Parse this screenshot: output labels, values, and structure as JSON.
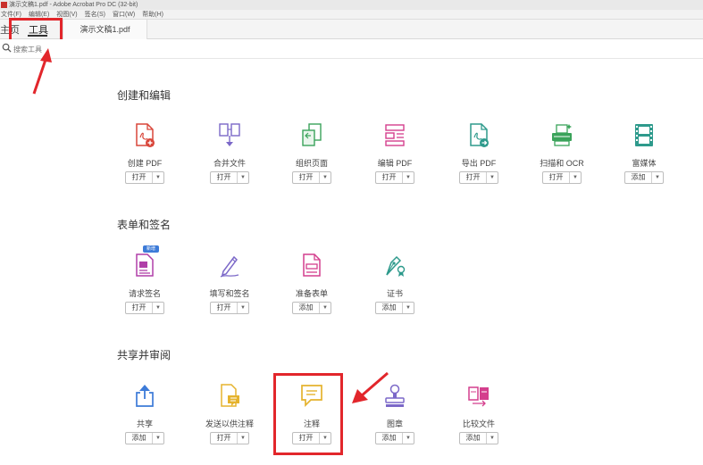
{
  "window": {
    "title": "演示文稿1.pdf - Adobe Acrobat Pro DC (32-bit)"
  },
  "menubar": {
    "items": [
      "文件(F)",
      "编辑(E)",
      "视图(V)",
      "签名(S)",
      "窗口(W)",
      "帮助(H)"
    ]
  },
  "tabs": {
    "home": "主页",
    "tools": "工具",
    "document": "演示文稿1.pdf"
  },
  "search": {
    "placeholder": "搜索工具"
  },
  "colors": {
    "highlight": "#e2262b",
    "accent_red": "#d9463a",
    "accent_purple": "#7b68c8",
    "accent_green": "#3aa35a",
    "accent_teal": "#2e9a8c",
    "accent_blue": "#3d7bd8",
    "accent_yellow": "#e5b32e",
    "accent_pink": "#d43f8d"
  },
  "sections": [
    {
      "title": "创建和编辑",
      "tools": [
        {
          "label": "创建 PDF",
          "action": "打开",
          "icon": "create-pdf-icon"
        },
        {
          "label": "合并文件",
          "action": "打开",
          "icon": "combine-files-icon"
        },
        {
          "label": "组织页面",
          "action": "打开",
          "icon": "organize-pages-icon"
        },
        {
          "label": "编辑 PDF",
          "action": "打开",
          "icon": "edit-pdf-icon"
        },
        {
          "label": "导出 PDF",
          "action": "打开",
          "icon": "export-pdf-icon"
        },
        {
          "label": "扫描和 OCR",
          "action": "打开",
          "icon": "scan-ocr-icon"
        },
        {
          "label": "富媒体",
          "action": "添加",
          "icon": "rich-media-icon"
        }
      ]
    },
    {
      "title": "表单和签名",
      "tools": [
        {
          "label": "请求签名",
          "action": "打开",
          "icon": "request-signature-icon",
          "badge": "新增"
        },
        {
          "label": "填写和签名",
          "action": "打开",
          "icon": "fill-sign-icon"
        },
        {
          "label": "准备表单",
          "action": "添加",
          "icon": "prepare-form-icon"
        },
        {
          "label": "证书",
          "action": "添加",
          "icon": "certificate-icon"
        }
      ]
    },
    {
      "title": "共享并审阅",
      "tools": [
        {
          "label": "共享",
          "action": "添加",
          "icon": "share-icon"
        },
        {
          "label": "发送以供注释",
          "action": "打开",
          "icon": "send-for-comment-icon"
        },
        {
          "label": "注释",
          "action": "打开",
          "icon": "comment-icon"
        },
        {
          "label": "图章",
          "action": "添加",
          "icon": "stamp-icon"
        },
        {
          "label": "比较文件",
          "action": "添加",
          "icon": "compare-files-icon"
        }
      ]
    }
  ]
}
